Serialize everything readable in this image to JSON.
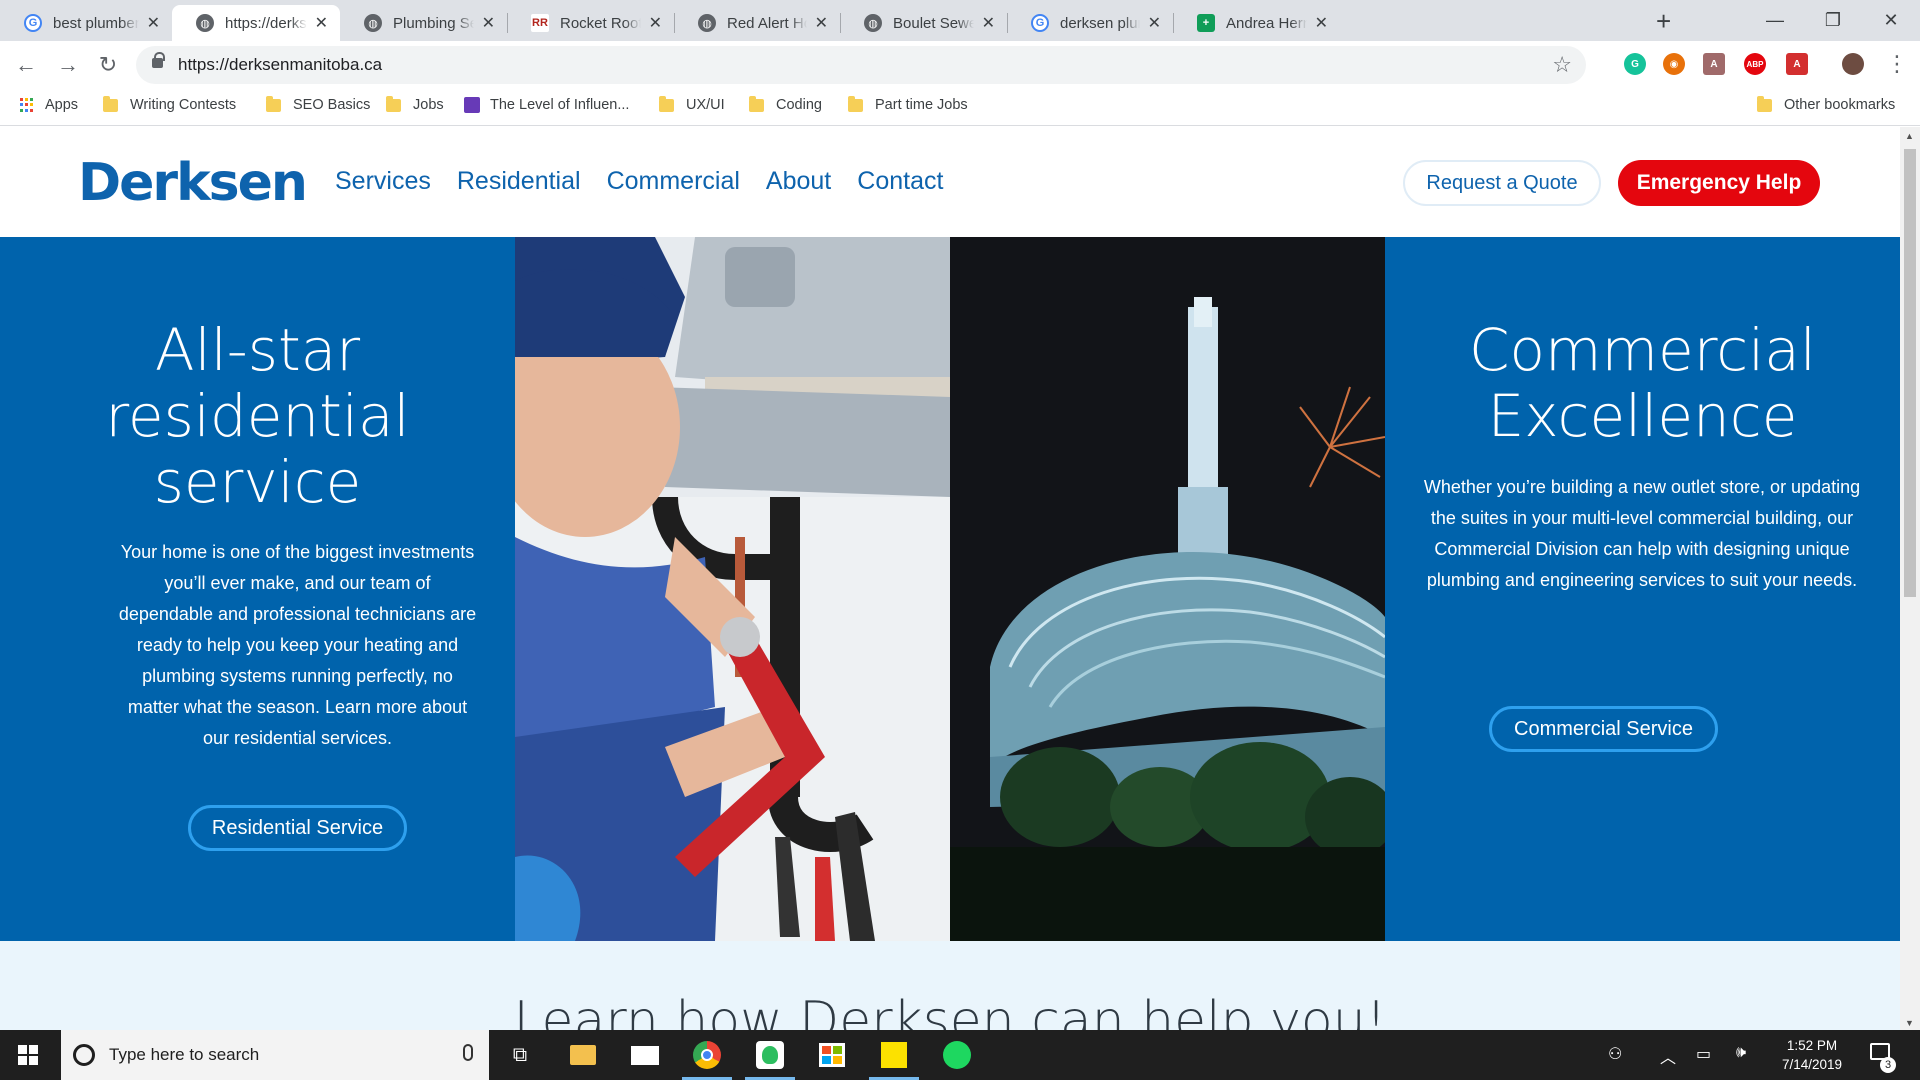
{
  "browser": {
    "tabs": [
      {
        "title": "best plumbers in winnipeg",
        "icon": "google-icon",
        "close": "✕"
      },
      {
        "title": "https://derksenmanitoba.ca",
        "icon": "globe-icon",
        "close": "✕"
      },
      {
        "title": "Plumbing Service & Repair",
        "icon": "globe-icon",
        "close": "✕"
      },
      {
        "title": "Rocket Rooter | Winnipeg",
        "icon": "rocket-rooter-icon",
        "close": "✕"
      },
      {
        "title": "Red Alert Home | Plumbing",
        "icon": "globe-icon",
        "close": "✕"
      },
      {
        "title": "Boulet Sewer & Drain",
        "icon": "globe-icon",
        "close": "✕"
      },
      {
        "title": "derksen plumbing",
        "icon": "google-icon",
        "close": "✕"
      },
      {
        "title": "Andrea Hernandez",
        "icon": "sheets-icon",
        "close": "✕"
      }
    ],
    "new_tab": "+",
    "url": "https://derksenmanitoba.ca",
    "bookmarks": [
      {
        "label": "Apps",
        "icon": "apps-grid-icon"
      },
      {
        "label": "Writing Contests",
        "icon": "folder-icon"
      },
      {
        "label": "SEO Basics",
        "icon": "folder-icon"
      },
      {
        "label": "Jobs",
        "icon": "folder-icon"
      },
      {
        "label": "The Level of Influen...",
        "icon": "page-icon"
      },
      {
        "label": "UX/UI",
        "icon": "folder-icon"
      },
      {
        "label": "Coding",
        "icon": "folder-icon"
      },
      {
        "label": "Part time Jobs",
        "icon": "folder-icon"
      }
    ],
    "other_bookmarks": "Other bookmarks",
    "extensions": [
      {
        "name": "grammarly-icon",
        "color": "#15c39a",
        "glyph": "G"
      },
      {
        "name": "extension-icon",
        "color": "#e8710a",
        "glyph": "◉"
      },
      {
        "name": "pdf-tool-icon",
        "color": "#a06a6a",
        "glyph": "A"
      },
      {
        "name": "adblock-plus-icon",
        "color": "#e4060e",
        "glyph": "ABP"
      },
      {
        "name": "acrobat-icon",
        "color": "#d32f2f",
        "glyph": "A"
      },
      {
        "name": "profile-avatar-icon",
        "color": "#6d4c41",
        "glyph": ""
      }
    ]
  },
  "site": {
    "logo": "Derksen",
    "nav": [
      "Services",
      "Residential",
      "Commercial",
      "About",
      "Contact"
    ],
    "quote_button": "Request a Quote",
    "emergency_button": "Emergency Help",
    "residential": {
      "title": "All-star residential service",
      "body": "Your home is one of the biggest investments you’ll ever make, and our team of dependable and professional technicians are ready to help you keep your heating and plumbing systems running perfectly, no matter what the season. Learn more about our residential services.",
      "button": "Residential Service"
    },
    "commercial": {
      "title": "Commercial Excellence",
      "body": "Whether you’re building a new outlet store, or updating the suites in your multi-level commercial building, our Commercial Division can help with designing unique plumbing and engineering services to suit your needs.",
      "button": "Commercial Service"
    },
    "intro_heading": "Learn how Derksen can help you!",
    "colors": {
      "brand_blue": "#0063ac",
      "logo_blue": "#0e63ad",
      "emergency_red": "#e4060e",
      "button_outline": "#2ea0ee"
    }
  },
  "taskbar": {
    "search_placeholder": "Type here to search",
    "apps": [
      "task-view-icon",
      "file-explorer-icon",
      "mail-icon",
      "chrome-icon",
      "evernote-icon",
      "store-icon",
      "sticky-notes-icon",
      "spotify-icon"
    ],
    "time": "1:52 PM",
    "date": "7/14/2019",
    "notifications": "3"
  }
}
